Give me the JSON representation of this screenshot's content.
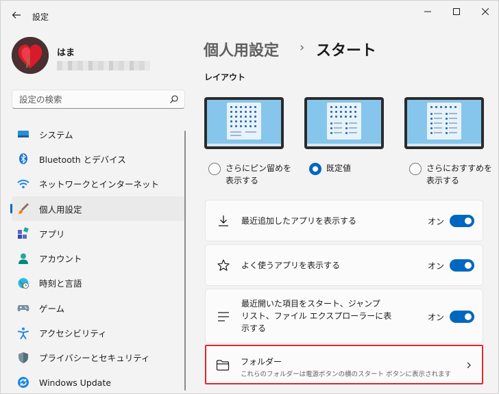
{
  "window": {
    "title": "設定"
  },
  "user": {
    "name": "はま"
  },
  "search": {
    "placeholder": "設定の検索"
  },
  "sidebar": {
    "items": [
      {
        "label": "システム",
        "icon": "system-icon"
      },
      {
        "label": "Bluetooth とデバイス",
        "icon": "bluetooth-icon"
      },
      {
        "label": "ネットワークとインターネット",
        "icon": "wifi-icon"
      },
      {
        "label": "個人用設定",
        "icon": "paintbrush-icon",
        "selected": true
      },
      {
        "label": "アプリ",
        "icon": "apps-icon"
      },
      {
        "label": "アカウント",
        "icon": "account-icon"
      },
      {
        "label": "時刻と言語",
        "icon": "clock-globe-icon"
      },
      {
        "label": "ゲーム",
        "icon": "gamepad-icon"
      },
      {
        "label": "アクセシビリティ",
        "icon": "accessibility-icon"
      },
      {
        "label": "プライバシーとセキュリティ",
        "icon": "shield-icon"
      },
      {
        "label": "Windows Update",
        "icon": "update-icon"
      }
    ]
  },
  "breadcrumb": {
    "parent": "個人用設定",
    "separator": "›",
    "current": "スタート"
  },
  "layout_section": {
    "title": "レイアウト",
    "options": [
      {
        "label_line1": "さらにピン留めを",
        "label_line2": "表示する",
        "checked": false
      },
      {
        "label_line1": "既定値",
        "label_line2": "",
        "checked": true
      },
      {
        "label_line1": "さらにおすすめを",
        "label_line2": "表示する",
        "checked": false
      }
    ]
  },
  "settings": {
    "recent_apps": {
      "label": "最近追加したアプリを表示する",
      "state": "オン",
      "on": true
    },
    "most_used": {
      "label": "よく使うアプリを表示する",
      "state": "オン",
      "on": true
    },
    "recent_items": {
      "label_line1": "最近開いた項目をスタート、ジャンプ",
      "label_line2": "リスト、ファイル エクスプローラーに表",
      "label_line3": "示する",
      "state": "オン",
      "on": true
    },
    "folders": {
      "title": "フォルダー",
      "description": "これらのフォルダーは電源ボタンの横のスタート ボタンに表示されます"
    }
  },
  "colors": {
    "accent": "#0067c0",
    "highlight_border": "#e0262b"
  }
}
